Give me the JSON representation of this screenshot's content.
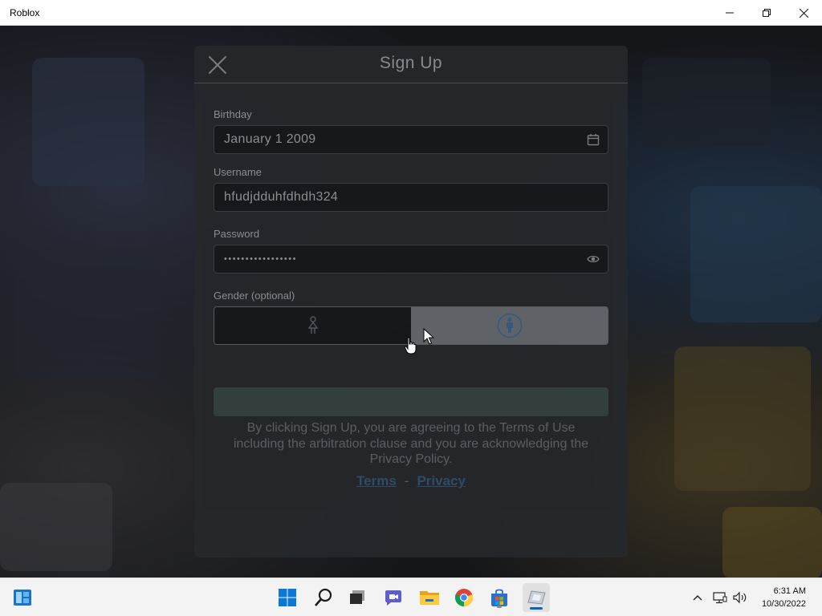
{
  "window": {
    "title": "Roblox",
    "controls": [
      "minimize",
      "restore",
      "close"
    ]
  },
  "modal": {
    "title": "Sign Up",
    "birthday": {
      "label": "Birthday",
      "value": "January 1 2009",
      "icon": "calendar-icon"
    },
    "username": {
      "label": "Username",
      "value": "hfudjdduhfdhdh324"
    },
    "password": {
      "label": "Password",
      "value": "•••••••••••••••••",
      "icon": "eye-icon"
    },
    "gender": {
      "label": "Gender (optional)",
      "options": [
        "female",
        "male"
      ],
      "selected": "male"
    },
    "signup_button": "",
    "legal_text": "By clicking Sign Up, you are agreeing to the Terms of Use including the arbitration clause and you are acknowledging the Privacy Policy.",
    "links": {
      "terms": "Terms",
      "separator": "-",
      "privacy": "Privacy"
    }
  },
  "taskbar": {
    "items": [
      "widgets-icon",
      "start-icon",
      "search-icon",
      "task-view-icon",
      "chat-icon",
      "file-explorer-icon",
      "chrome-icon",
      "store-icon",
      "roblox-icon"
    ],
    "tray": [
      "chevron-up-icon",
      "network-icon",
      "volume-icon"
    ],
    "time": "6:31 AM",
    "date": "10/30/2022"
  },
  "colors": {
    "modal_bg": "#25272b",
    "field_bg": "#17181b",
    "link": "#2e4e6b",
    "accent": "#0067c0"
  }
}
